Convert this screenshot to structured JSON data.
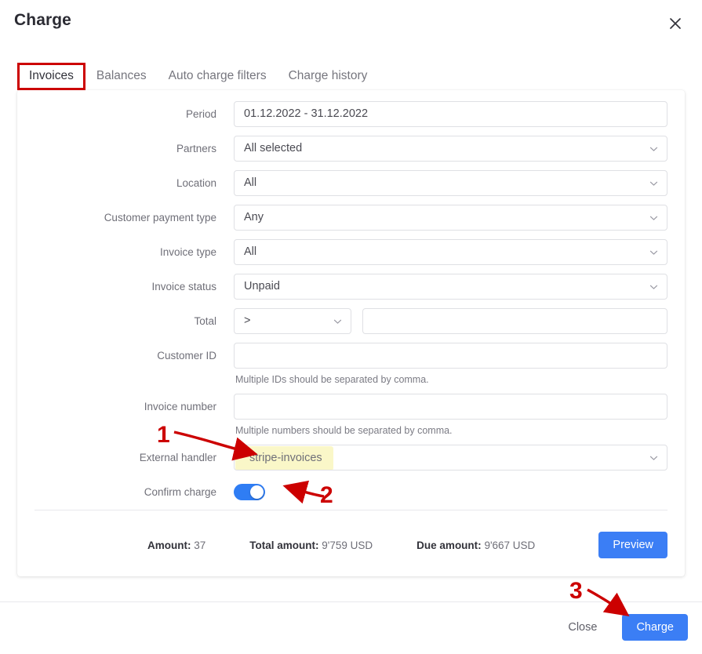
{
  "dialog": {
    "title": "Charge",
    "close_icon": "close-icon"
  },
  "tabs": [
    {
      "label": "Invoices",
      "active": true,
      "highlighted": true
    },
    {
      "label": "Balances",
      "active": false,
      "highlighted": false
    },
    {
      "label": "Auto charge filters",
      "active": false,
      "highlighted": false
    },
    {
      "label": "Charge history",
      "active": false,
      "highlighted": false
    }
  ],
  "form": {
    "period": {
      "label": "Period",
      "value": "01.12.2022 - 31.12.2022"
    },
    "partners": {
      "label": "Partners",
      "value": "All selected"
    },
    "location": {
      "label": "Location",
      "value": "All"
    },
    "customer_payment_type": {
      "label": "Customer payment type",
      "value": "Any"
    },
    "invoice_type": {
      "label": "Invoice type",
      "value": "All"
    },
    "invoice_status": {
      "label": "Invoice status",
      "value": "Unpaid"
    },
    "total": {
      "label": "Total",
      "operator": ">",
      "value": ""
    },
    "customer_id": {
      "label": "Customer ID",
      "value": "",
      "hint": "Multiple IDs should be separated by comma."
    },
    "invoice_number": {
      "label": "Invoice number",
      "value": "",
      "hint": "Multiple numbers should be separated by comma."
    },
    "external_handler": {
      "label": "External handler",
      "value": "stripe-invoices"
    },
    "confirm_charge": {
      "label": "Confirm charge",
      "state": "on"
    }
  },
  "summary": {
    "amount_label": "Amount:",
    "amount_value": "37",
    "total_amount_label": "Total amount:",
    "total_amount_value": "9'759 USD",
    "due_amount_label": "Due amount:",
    "due_amount_value": "9'667 USD",
    "preview_button": "Preview"
  },
  "footer": {
    "close_button": "Close",
    "charge_button": "Charge"
  },
  "annotations": {
    "one": "1",
    "two": "2",
    "three": "3",
    "color": "#cc0000"
  },
  "colors": {
    "primary_blue": "#3b7ef5",
    "toggle_blue": "#2f7df4",
    "autofill_yellow": "#faf7c8",
    "annotation_red": "#cc0000",
    "border_gray": "#dfe0e4",
    "label_gray": "#6f6f78"
  }
}
